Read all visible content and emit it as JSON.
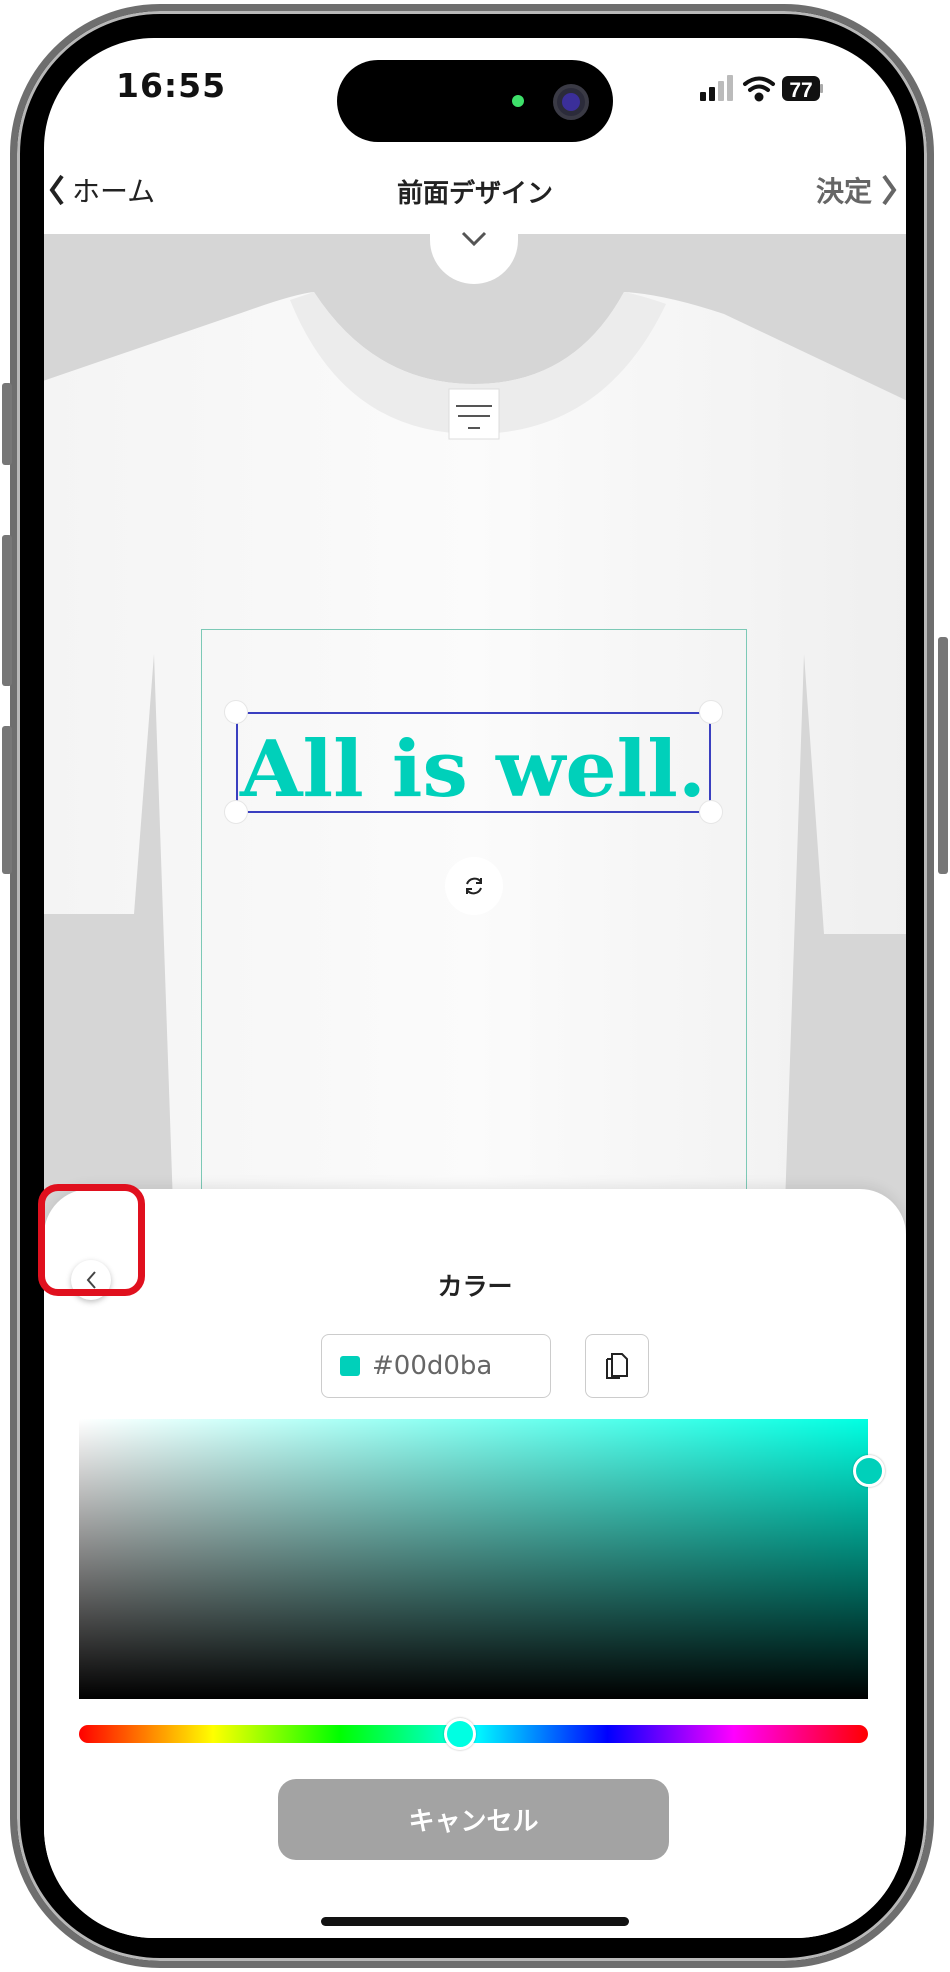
{
  "status_bar": {
    "time": "16:55",
    "battery": "77",
    "icons": [
      "signal-icon",
      "wifi-icon",
      "battery-icon"
    ]
  },
  "nav": {
    "back_label": "ホーム",
    "title": "前面デザイン",
    "confirm_label": "決定"
  },
  "design": {
    "text": "All is well.",
    "text_color": "#00d0ba",
    "selection_color": "#3a3fc0"
  },
  "color_panel": {
    "title": "カラー",
    "hex_value": "#00d0ba",
    "cancel_label": "キャンセル",
    "hue_degrees": 174
  },
  "highlight_color": "#e0101e"
}
